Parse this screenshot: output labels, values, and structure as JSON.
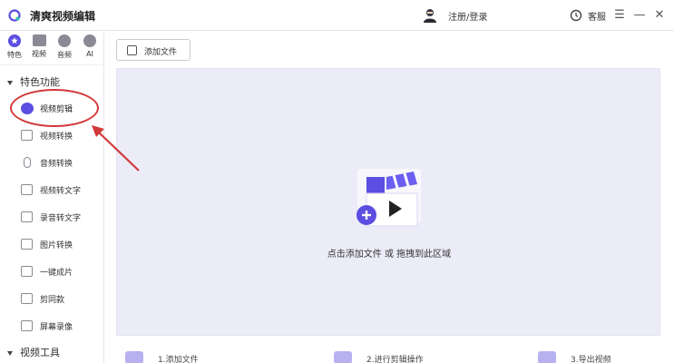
{
  "app": {
    "title": "清爽视频编辑"
  },
  "header": {
    "login_label": "注册/登录",
    "service_label": "客服",
    "menu_glyph": "☰",
    "minimize_glyph": "—",
    "close_glyph": "✕"
  },
  "icon_tabs": [
    {
      "label": "特色",
      "icon": "star-icon"
    },
    {
      "label": "视频",
      "icon": "film-icon"
    },
    {
      "label": "音频",
      "icon": "mic-icon"
    },
    {
      "label": "AI",
      "icon": "ai-icon"
    }
  ],
  "sidebar": {
    "section_features": "特色功能",
    "items": [
      {
        "label": "视频剪辑",
        "icon": "video-edit-icon",
        "active": true
      },
      {
        "label": "视频转换",
        "icon": "video-convert-icon"
      },
      {
        "label": "音频转换",
        "icon": "microphone-icon"
      },
      {
        "label": "视频转文字",
        "icon": "video-to-text-icon"
      },
      {
        "label": "录音转文字",
        "icon": "audio-to-text-icon"
      },
      {
        "label": "图片转换",
        "icon": "image-icon"
      },
      {
        "label": "一键成片",
        "icon": "one-click-film-icon"
      },
      {
        "label": "剪同款",
        "icon": "template-icon"
      },
      {
        "label": "屏幕录像",
        "icon": "screen-record-icon"
      }
    ],
    "section_tools": "视频工具"
  },
  "main": {
    "add_file_label": "添加文件",
    "drop_text": "点击添加文件 或 拖拽到此区域"
  },
  "steps": [
    {
      "label": "1.添加文件"
    },
    {
      "label": "2.进行剪辑操作"
    },
    {
      "label": "3.导出视频"
    }
  ],
  "colors": {
    "accent": "#5b4ee0",
    "dropzone_bg": "#ececf8",
    "annotation_red": "#d2393a"
  }
}
